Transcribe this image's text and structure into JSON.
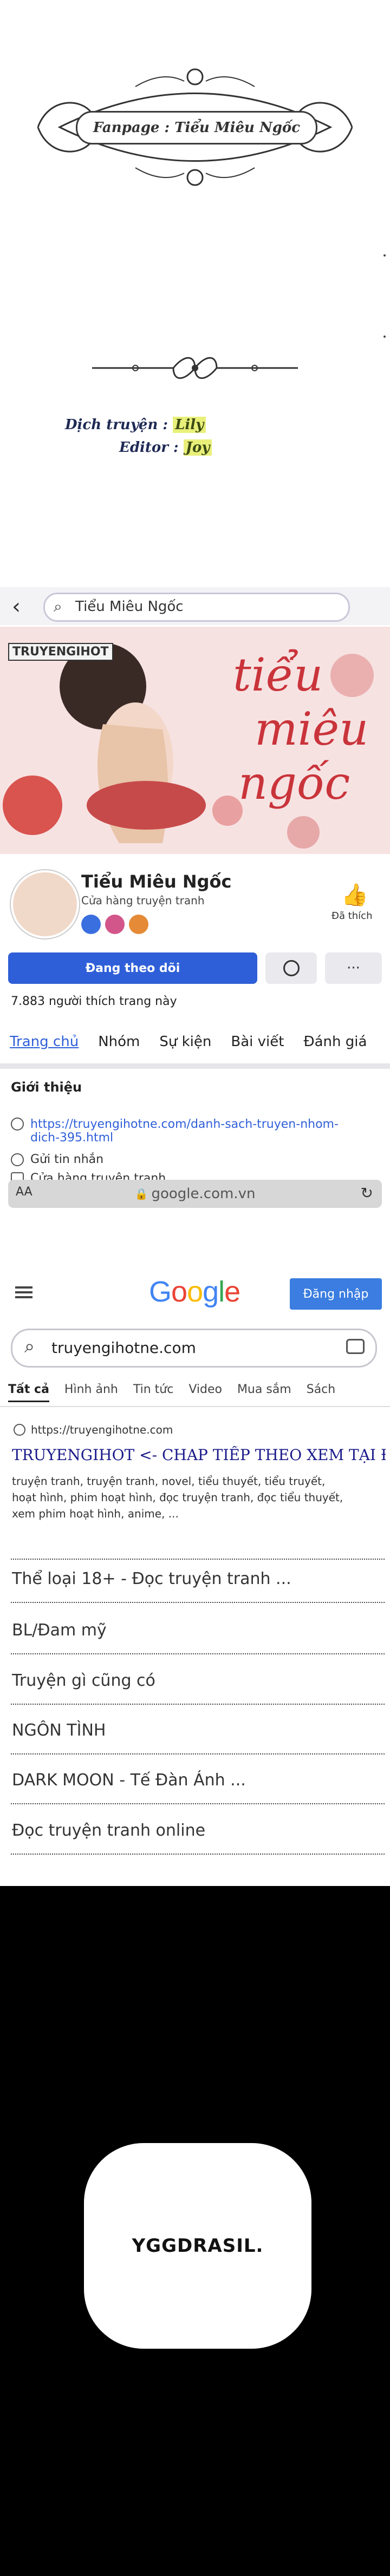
{
  "credits": {
    "fanpage": "Fanpage : Tiểu Miêu Ngốc",
    "translator_label": "Dịch truyện :",
    "translator_value": "Lily",
    "editor_label": "Editor :",
    "editor_value": "Joy"
  },
  "facebook": {
    "search_query": "Tiểu Miêu Ngốc",
    "cover_tag": "TRUYENGIHOT",
    "cover_title_1": "tiểu",
    "cover_title_2": "miêu",
    "cover_title_3": "ngốc",
    "page_name": "Tiểu Miêu Ngốc",
    "page_category": "Cửa hàng truyện tranh",
    "share_label": "Đã thích",
    "follow_label": "Đang theo dõi",
    "more_label": "···",
    "likes_text": "7.883 người thích trang này",
    "tabs": [
      "Trang chủ",
      "Nhóm",
      "Sự kiện",
      "Bài viết",
      "Đánh giá"
    ],
    "intro_heading": "Giới thiệu",
    "intro_link_1": "https://truyengihotne.com/danh-sach-truyen-nhom-",
    "intro_link_2": "dich-395.html",
    "intro_message": "Gửi tin nhắn",
    "intro_category": "Cửa hàng truyện tranh"
  },
  "browser": {
    "tab_left": "AA",
    "url": "google.com.vn"
  },
  "google": {
    "logo": "Google",
    "signin_label": "Đăng nhập",
    "query": "truyengihotne.com",
    "tabs": [
      "Tất cả",
      "Hình ảnh",
      "Tin tức",
      "Video",
      "Mua sắm",
      "Sách"
    ],
    "result_url": "https://truyengihotne.com",
    "result_title": "TRUYENGIHOT <- CHAP TIẾP THEO XEM TẠI ĐÂY NHA",
    "result_snippet_1": "truyện tranh, truyện tranh, novel, tiểu thuyết, tiểu truyết,",
    "result_snippet_2": "hoạt hình, phim hoạt hình, đọc truyện tranh, đọc tiểu thuyết,",
    "result_snippet_3": "xem phim hoạt hình, anime, ...",
    "sublinks": [
      "Thể loại 18+ - Đọc truyện tranh ...",
      "BL/Đam mỹ",
      "Truyện gì cũng có",
      "NGÔN TÌNH",
      "DARK MOON - Tế Đàn Ánh ...",
      "Đọc truyện tranh online"
    ]
  },
  "bubble_text": "YGGDRASIL.",
  "colors": {
    "fb_blue": "#2f5fd8",
    "google_blue": "#4285f4",
    "google_red": "#ea4335",
    "google_yellow": "#fbbc05",
    "google_green": "#34a853",
    "cover_pink": "#f5dcdc"
  }
}
